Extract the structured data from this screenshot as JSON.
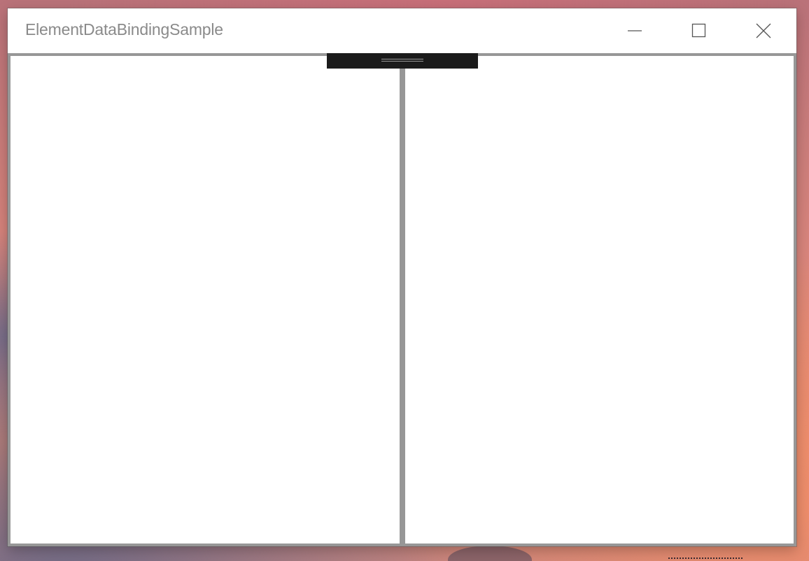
{
  "window": {
    "title": "ElementDataBindingSample",
    "buttons": {
      "minimize": "minimize-icon",
      "maximize": "maximize-icon",
      "close": "close-icon"
    }
  },
  "colors": {
    "titlebar_background": "#ffffff",
    "title_text": "#8a8a8a",
    "pane_border": "#979797",
    "splitter_handle": "#1b1b1b",
    "pane_background": "#ffffff"
  },
  "panes": {
    "left": {
      "content": ""
    },
    "right": {
      "content": ""
    }
  },
  "splitter": {
    "handle_icon": "drag-grip-icon"
  }
}
